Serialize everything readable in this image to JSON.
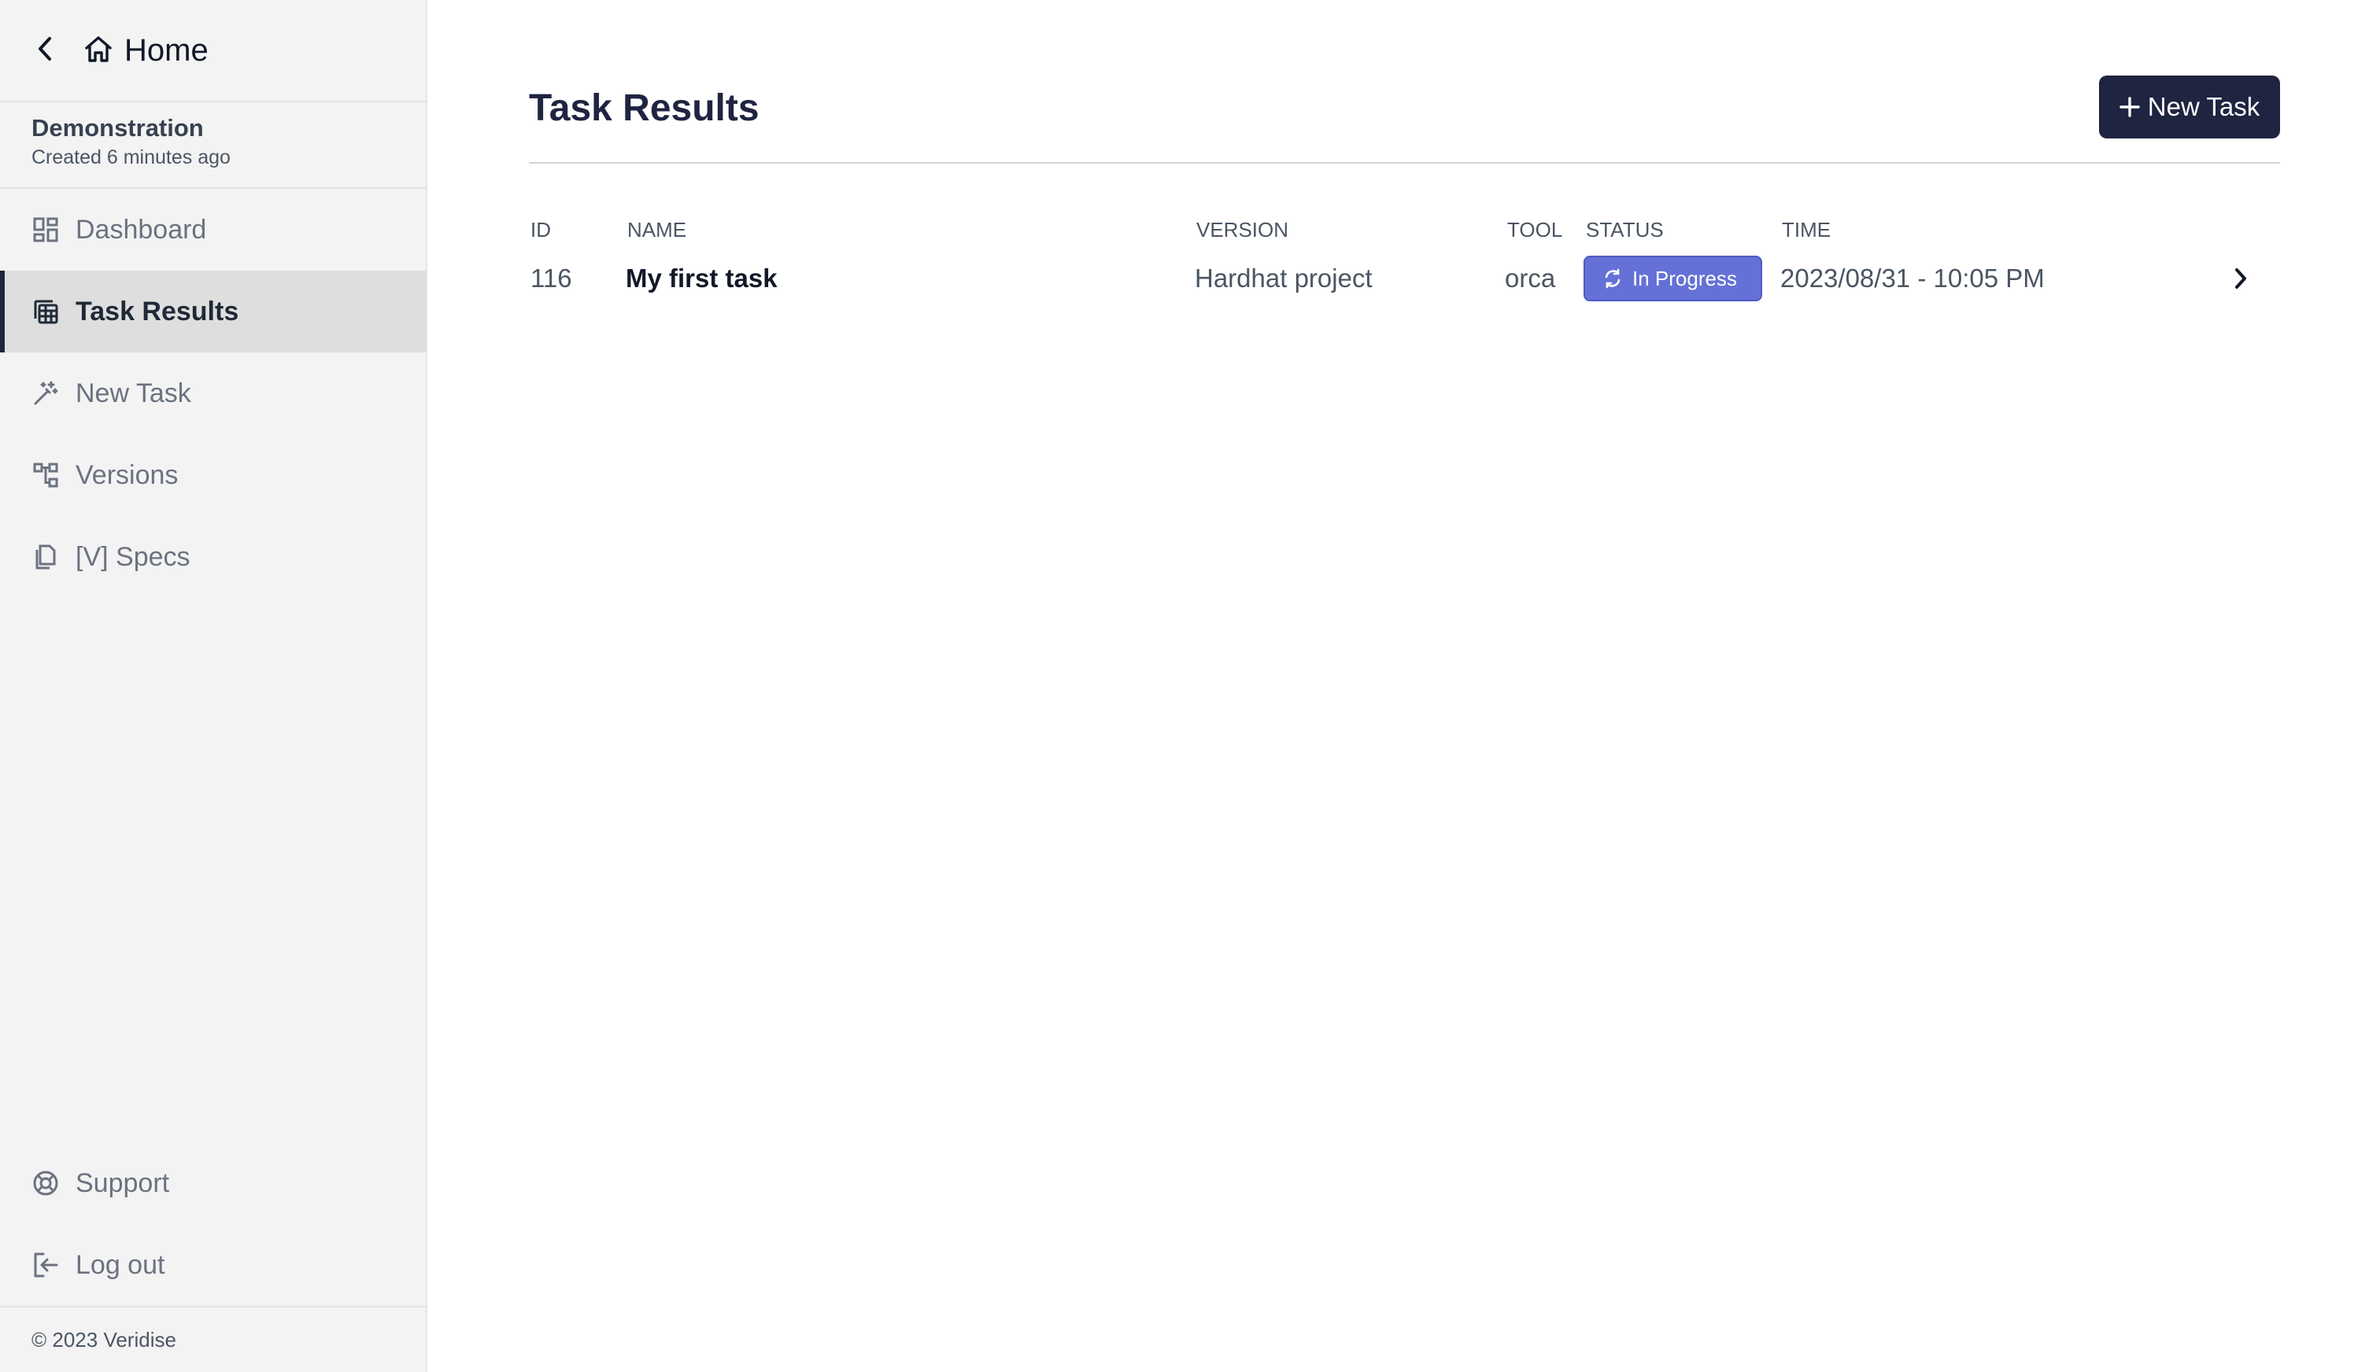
{
  "sidebar": {
    "home_label": "Home",
    "project": {
      "name": "Demonstration",
      "meta": "Created 6 minutes ago"
    },
    "nav": [
      {
        "label": "Dashboard",
        "icon": "dashboard-icon"
      },
      {
        "label": "Task Results",
        "icon": "table-icon",
        "active": true
      },
      {
        "label": "New Task",
        "icon": "wand-icon"
      },
      {
        "label": "Versions",
        "icon": "hierarchy-icon"
      },
      {
        "label": "[V] Specs",
        "icon": "copy-icon"
      }
    ],
    "bottom": [
      {
        "label": "Support",
        "icon": "lifebuoy-icon"
      },
      {
        "label": "Log out",
        "icon": "logout-icon"
      }
    ],
    "footer": "© 2023 Veridise"
  },
  "main": {
    "title": "Task Results",
    "new_task_label": "New Task",
    "table": {
      "headers": {
        "id": "ID",
        "name": "NAME",
        "version": "VERSION",
        "tool": "TOOL",
        "status": "STATUS",
        "time": "TIME"
      },
      "rows": [
        {
          "id": "116",
          "name": "My first task",
          "version": "Hardhat project",
          "tool": "orca",
          "status": "In Progress",
          "time": "2023/08/31 - 10:05 PM"
        }
      ]
    }
  },
  "colors": {
    "accent": "#1f2440",
    "status_in_progress": "#6571d6",
    "sidebar_bg": "#f3f3f3"
  }
}
